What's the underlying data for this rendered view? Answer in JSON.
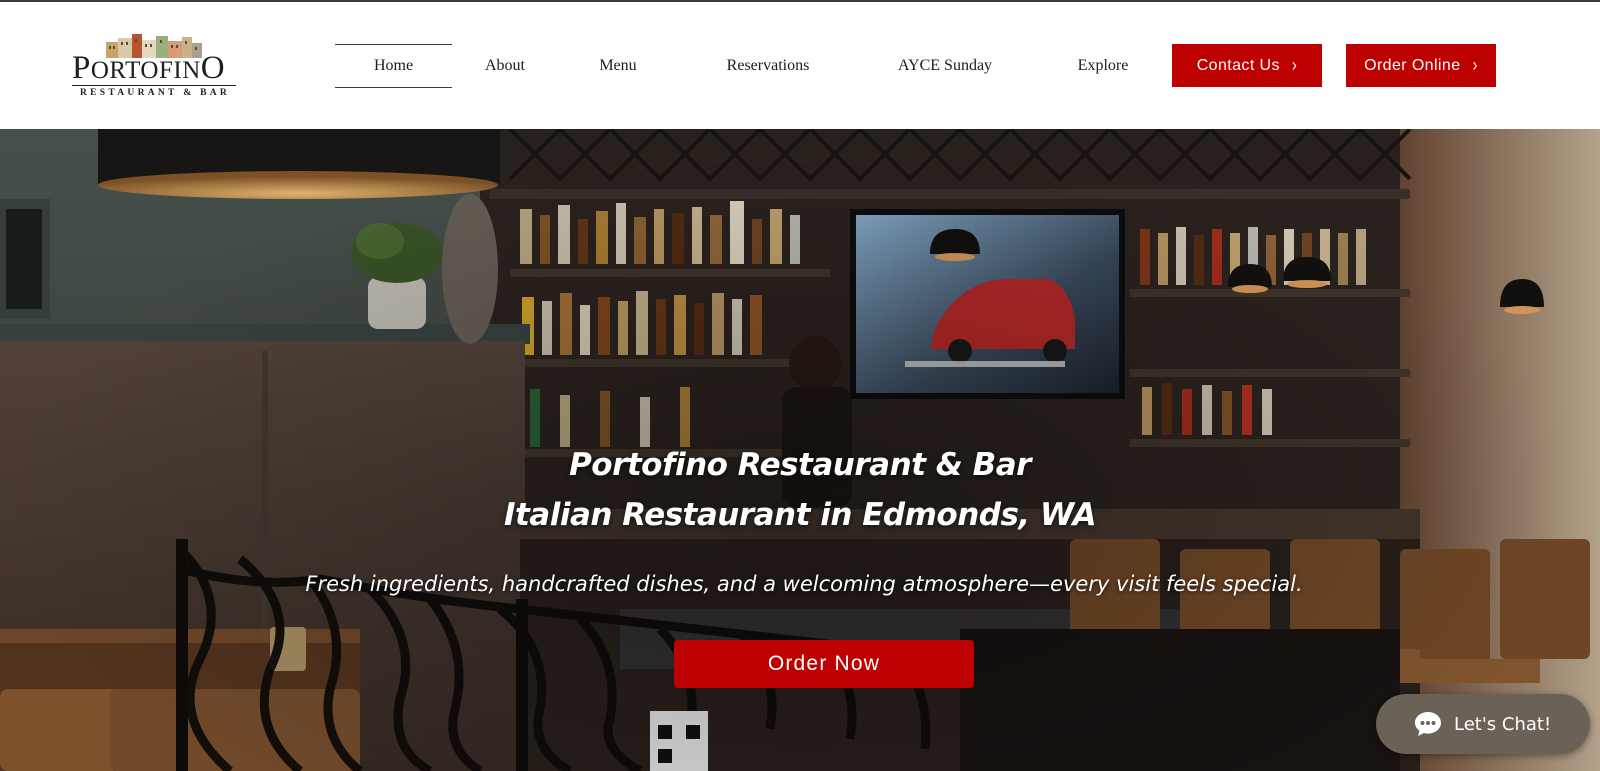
{
  "logo": {
    "wordmark_initial": "P",
    "wordmark_rest": "ORTOFIN",
    "wordmark_end": "O",
    "tagline": "RESTAURANT & BAR"
  },
  "nav": {
    "items": [
      {
        "label": "Home",
        "active": true
      },
      {
        "label": "About"
      },
      {
        "label": "Menu"
      },
      {
        "label": "Reservations"
      },
      {
        "label": "AYCE Sunday"
      },
      {
        "label": "Explore"
      }
    ]
  },
  "header_buttons": {
    "contact": "Contact Us",
    "order_online": "Order Online",
    "chevron": "›"
  },
  "hero": {
    "title_line1": "Portofino Restaurant & Bar",
    "title_line2": "Italian Restaurant in Edmonds, WA",
    "subtitle": "Fresh ingredients, handcrafted dishes, and a welcoming atmosphere—every visit feels special.",
    "cta": "Order Now",
    "background": "photo of restaurant bar interior"
  },
  "chat": {
    "label": "Let's Chat!",
    "icon": "chat-bubble-icon"
  },
  "colors": {
    "brand_red": "#bd0000",
    "chat_bg": "#6b6257",
    "text_dark": "#1d1d1d"
  }
}
